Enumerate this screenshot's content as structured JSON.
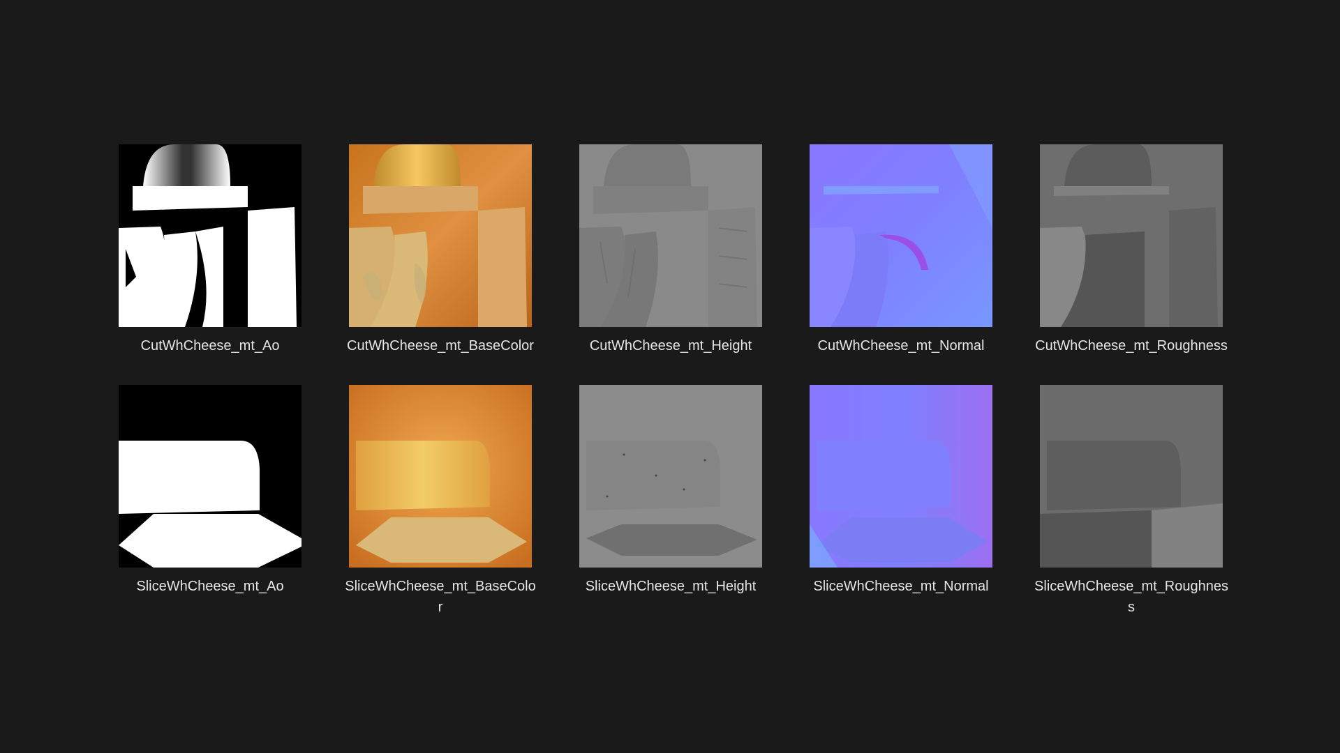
{
  "files": [
    {
      "name": "CutWhCheese_mt_Ao",
      "kind": "ao-cut"
    },
    {
      "name": "CutWhCheese_mt_BaseColor",
      "kind": "basecolor-cut"
    },
    {
      "name": "CutWhCheese_mt_Height",
      "kind": "height-cut"
    },
    {
      "name": "CutWhCheese_mt_Normal",
      "kind": "normal-cut"
    },
    {
      "name": "CutWhCheese_mt_Roughness",
      "kind": "roughness-cut"
    },
    {
      "name": "SliceWhCheese_mt_Ao",
      "kind": "ao-slice"
    },
    {
      "name": "SliceWhCheese_mt_BaseColor",
      "kind": "basecolor-slice"
    },
    {
      "name": "SliceWhCheese_mt_Height",
      "kind": "height-slice"
    },
    {
      "name": "SliceWhCheese_mt_Normal",
      "kind": "normal-slice"
    },
    {
      "name": "SliceWhCheese_mt_Roughness",
      "kind": "roughness-slice"
    }
  ]
}
